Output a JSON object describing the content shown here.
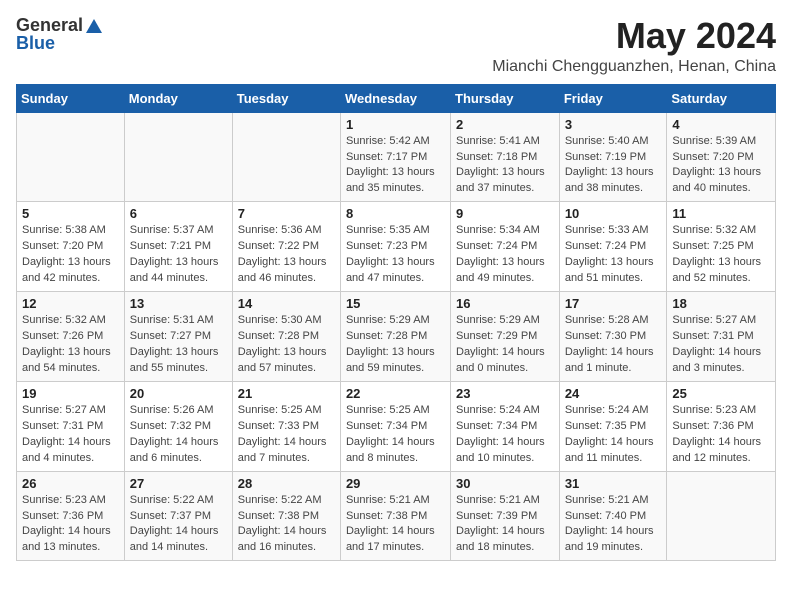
{
  "logo": {
    "general": "General",
    "blue": "Blue"
  },
  "header": {
    "month": "May 2024",
    "location": "Mianchi Chengguanzhen, Henan, China"
  },
  "days_of_week": [
    "Sunday",
    "Monday",
    "Tuesday",
    "Wednesday",
    "Thursday",
    "Friday",
    "Saturday"
  ],
  "weeks": [
    [
      {
        "day": "",
        "detail": ""
      },
      {
        "day": "",
        "detail": ""
      },
      {
        "day": "",
        "detail": ""
      },
      {
        "day": "1",
        "detail": "Sunrise: 5:42 AM\nSunset: 7:17 PM\nDaylight: 13 hours\nand 35 minutes."
      },
      {
        "day": "2",
        "detail": "Sunrise: 5:41 AM\nSunset: 7:18 PM\nDaylight: 13 hours\nand 37 minutes."
      },
      {
        "day": "3",
        "detail": "Sunrise: 5:40 AM\nSunset: 7:19 PM\nDaylight: 13 hours\nand 38 minutes."
      },
      {
        "day": "4",
        "detail": "Sunrise: 5:39 AM\nSunset: 7:20 PM\nDaylight: 13 hours\nand 40 minutes."
      }
    ],
    [
      {
        "day": "5",
        "detail": "Sunrise: 5:38 AM\nSunset: 7:20 PM\nDaylight: 13 hours\nand 42 minutes."
      },
      {
        "day": "6",
        "detail": "Sunrise: 5:37 AM\nSunset: 7:21 PM\nDaylight: 13 hours\nand 44 minutes."
      },
      {
        "day": "7",
        "detail": "Sunrise: 5:36 AM\nSunset: 7:22 PM\nDaylight: 13 hours\nand 46 minutes."
      },
      {
        "day": "8",
        "detail": "Sunrise: 5:35 AM\nSunset: 7:23 PM\nDaylight: 13 hours\nand 47 minutes."
      },
      {
        "day": "9",
        "detail": "Sunrise: 5:34 AM\nSunset: 7:24 PM\nDaylight: 13 hours\nand 49 minutes."
      },
      {
        "day": "10",
        "detail": "Sunrise: 5:33 AM\nSunset: 7:24 PM\nDaylight: 13 hours\nand 51 minutes."
      },
      {
        "day": "11",
        "detail": "Sunrise: 5:32 AM\nSunset: 7:25 PM\nDaylight: 13 hours\nand 52 minutes."
      }
    ],
    [
      {
        "day": "12",
        "detail": "Sunrise: 5:32 AM\nSunset: 7:26 PM\nDaylight: 13 hours\nand 54 minutes."
      },
      {
        "day": "13",
        "detail": "Sunrise: 5:31 AM\nSunset: 7:27 PM\nDaylight: 13 hours\nand 55 minutes."
      },
      {
        "day": "14",
        "detail": "Sunrise: 5:30 AM\nSunset: 7:28 PM\nDaylight: 13 hours\nand 57 minutes."
      },
      {
        "day": "15",
        "detail": "Sunrise: 5:29 AM\nSunset: 7:28 PM\nDaylight: 13 hours\nand 59 minutes."
      },
      {
        "day": "16",
        "detail": "Sunrise: 5:29 AM\nSunset: 7:29 PM\nDaylight: 14 hours\nand 0 minutes."
      },
      {
        "day": "17",
        "detail": "Sunrise: 5:28 AM\nSunset: 7:30 PM\nDaylight: 14 hours\nand 1 minute."
      },
      {
        "day": "18",
        "detail": "Sunrise: 5:27 AM\nSunset: 7:31 PM\nDaylight: 14 hours\nand 3 minutes."
      }
    ],
    [
      {
        "day": "19",
        "detail": "Sunrise: 5:27 AM\nSunset: 7:31 PM\nDaylight: 14 hours\nand 4 minutes."
      },
      {
        "day": "20",
        "detail": "Sunrise: 5:26 AM\nSunset: 7:32 PM\nDaylight: 14 hours\nand 6 minutes."
      },
      {
        "day": "21",
        "detail": "Sunrise: 5:25 AM\nSunset: 7:33 PM\nDaylight: 14 hours\nand 7 minutes."
      },
      {
        "day": "22",
        "detail": "Sunrise: 5:25 AM\nSunset: 7:34 PM\nDaylight: 14 hours\nand 8 minutes."
      },
      {
        "day": "23",
        "detail": "Sunrise: 5:24 AM\nSunset: 7:34 PM\nDaylight: 14 hours\nand 10 minutes."
      },
      {
        "day": "24",
        "detail": "Sunrise: 5:24 AM\nSunset: 7:35 PM\nDaylight: 14 hours\nand 11 minutes."
      },
      {
        "day": "25",
        "detail": "Sunrise: 5:23 AM\nSunset: 7:36 PM\nDaylight: 14 hours\nand 12 minutes."
      }
    ],
    [
      {
        "day": "26",
        "detail": "Sunrise: 5:23 AM\nSunset: 7:36 PM\nDaylight: 14 hours\nand 13 minutes."
      },
      {
        "day": "27",
        "detail": "Sunrise: 5:22 AM\nSunset: 7:37 PM\nDaylight: 14 hours\nand 14 minutes."
      },
      {
        "day": "28",
        "detail": "Sunrise: 5:22 AM\nSunset: 7:38 PM\nDaylight: 14 hours\nand 16 minutes."
      },
      {
        "day": "29",
        "detail": "Sunrise: 5:21 AM\nSunset: 7:38 PM\nDaylight: 14 hours\nand 17 minutes."
      },
      {
        "day": "30",
        "detail": "Sunrise: 5:21 AM\nSunset: 7:39 PM\nDaylight: 14 hours\nand 18 minutes."
      },
      {
        "day": "31",
        "detail": "Sunrise: 5:21 AM\nSunset: 7:40 PM\nDaylight: 14 hours\nand 19 minutes."
      },
      {
        "day": "",
        "detail": ""
      }
    ]
  ]
}
